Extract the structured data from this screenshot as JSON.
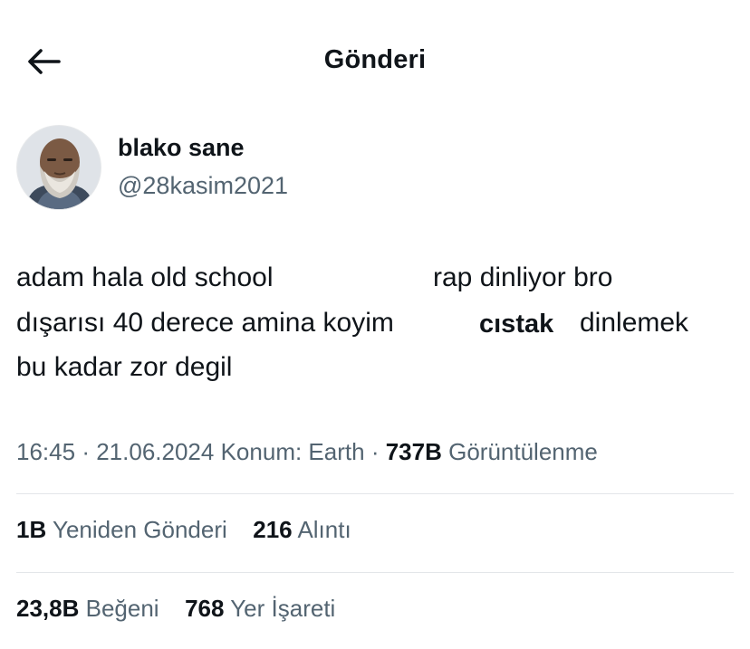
{
  "header": {
    "title": "Gönderi",
    "back_icon": "arrow-left-icon"
  },
  "author": {
    "display_name": "blako sane",
    "handle": "@28kasim2021",
    "avatar": "avatar-photo"
  },
  "tweet": {
    "line1_part1": "adam hala old school",
    "line1_part2": "rap dinliyor bro",
    "line2_part1": "dışarısı 40 derece amina koyim",
    "line2_part2": "cıstak",
    "line2_part3": "dinlemek",
    "line3": "bu kadar zor degil"
  },
  "meta": {
    "time": "16:45",
    "date": "21.06.2024",
    "location": "Konum: Earth",
    "views_count": "737B",
    "views_label": "Görüntülenme",
    "separator": "·"
  },
  "stats": {
    "reposts_count": "1B",
    "reposts_label": "Yeniden Gönderi",
    "quotes_count": "216",
    "quotes_label": "Alıntı",
    "likes_count": "23,8B",
    "likes_label": "Beğeni",
    "bookmarks_count": "768",
    "bookmarks_label": "Yer İşareti"
  },
  "colors": {
    "text_primary": "#0f1419",
    "text_secondary": "#536471",
    "divider": "#e3e6e9"
  }
}
